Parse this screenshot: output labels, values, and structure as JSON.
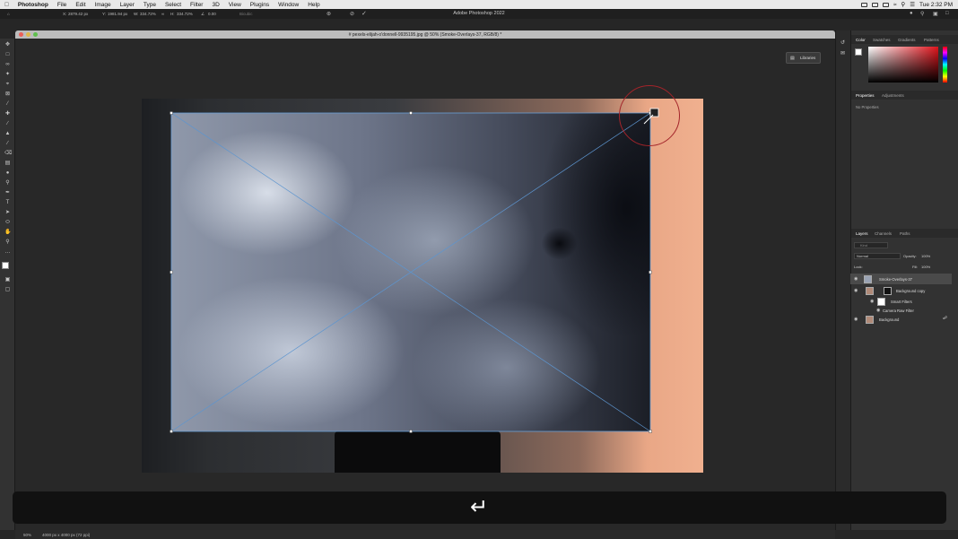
{
  "menubar": {
    "app_name": "Photoshop",
    "items": [
      "File",
      "Edit",
      "Image",
      "Layer",
      "Type",
      "Select",
      "Filter",
      "3D",
      "View",
      "Plugins",
      "Window",
      "Help"
    ],
    "clock": "Tue 2:32 PM"
  },
  "options_bar": {
    "x_label": "X:",
    "x_value": "2879.42 px",
    "y_label": "Y:",
    "y_value": "1981.94 px",
    "w_label": "W:",
    "w_value": "334.72%",
    "h_label": "H:",
    "h_value": "334.72%",
    "angle_value": "0.00",
    "interp_value": "Bicubic",
    "app_title": "Adobe Photoshop 2022"
  },
  "document": {
    "title": "# pexels-elijah-o'donnell-9935195.jpg @ 50% (Smoke-Overlays-37, RGB/8) *"
  },
  "libraries_button": "Libraries",
  "color_panel": {
    "tabs": [
      "Color",
      "Swatches",
      "Gradients",
      "Patterns"
    ],
    "active": "Color",
    "foreground": "#ffffff",
    "hue": "#e0141c"
  },
  "properties_panel": {
    "tabs": [
      "Properties",
      "Adjustments"
    ],
    "message": "No Properties"
  },
  "layers_panel": {
    "tabs": [
      "Layers",
      "Channels",
      "Paths"
    ],
    "kind_placeholder": "Kind",
    "blend_mode": "Normal",
    "opacity_label": "Opacity:",
    "opacity_value": "100%",
    "lock_label": "Lock:",
    "fill_label": "Fill:",
    "fill_value": "100%",
    "layers": [
      {
        "name": "Smoke-Overlays-37"
      },
      {
        "name": "Background copy"
      },
      {
        "name": "Smart Filters"
      },
      {
        "name": "Camera Raw Filter"
      },
      {
        "name": "Background"
      }
    ]
  },
  "status_bar": {
    "zoom": "50%",
    "doc_size": "4000 px x 4000 px (72 ppi)"
  },
  "overlay": {
    "icon": "return-arrow-icon"
  }
}
